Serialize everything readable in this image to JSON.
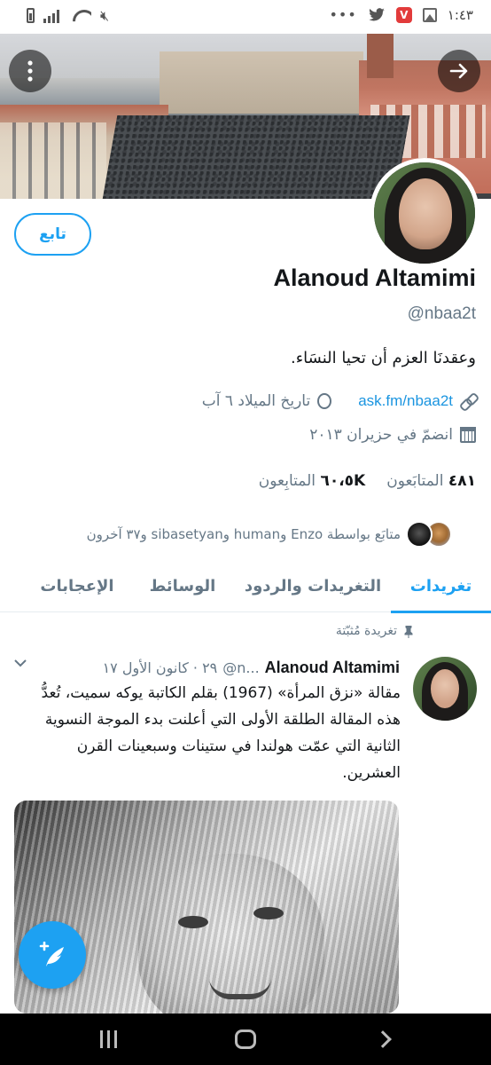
{
  "status_bar": {
    "time": "١:٤٣",
    "dots": "•••"
  },
  "profile": {
    "display_name": "Alanoud Altamimi",
    "username": "@nbaa2t",
    "bio": "وعقدنَا العزم أن تحيا النسَاء.",
    "follow_button": "تابع",
    "website": "ask.fm/nbaa2t",
    "birthday": "تاريخ الميلاد ٦ آب",
    "joined": "انضمّ في حزيران ٢٠١٣",
    "following_count": "٤٨١",
    "following_label": "المتابَعون",
    "followers_count": "٦٠،٥K",
    "followers_label": "المتابِعون",
    "followers_you_know": "متابَع بواسطة Enzo وhuman وsibasetyan و٣٧ آخرون"
  },
  "tabs": [
    {
      "label": "تغريدات",
      "active": true
    },
    {
      "label": "التغريدات والردود",
      "active": false
    },
    {
      "label": "الوسائط",
      "active": false
    },
    {
      "label": "الإعجابات",
      "active": false
    }
  ],
  "pinned_tweet": {
    "pinned_label": "تغريدة مُثبّتة",
    "author_name": "Alanoud Altamimi",
    "author_handle_truncated": "@n...",
    "date": "٢٩ · كانون الأول ١٧",
    "text": "مقالة «نزق المرأة» (1967) بقلم الكاتبة يوكه سميت، تُعدُّ هذه المقالة الطلقة الأولى التي أعلنت بدء الموجة النسوية الثانية التي عمّت هولندا في ستينات وسبعينات القرن العشرين."
  },
  "icons": {
    "menu": "more-vertical-icon",
    "next": "arrow-right-icon",
    "link": "link-icon",
    "birthday": "balloon-icon",
    "joined": "calendar-icon",
    "pin": "pin-icon",
    "caret": "chevron-down-icon",
    "compose": "compose-tweet-icon"
  },
  "colors": {
    "accent": "#1da1f2",
    "link": "#1b95e0",
    "secondary_text": "#657786"
  }
}
